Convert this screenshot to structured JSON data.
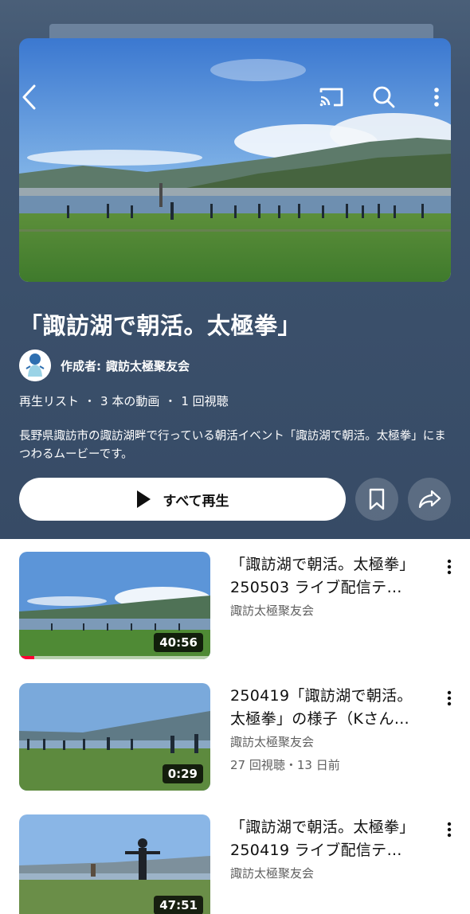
{
  "header": {
    "title": "「諏訪湖で朝活。太極拳」",
    "channel_prefix": "作成者:",
    "channel_name": "諏訪太極聚友会",
    "meta": {
      "type": "再生リスト",
      "video_count": "3 本の動画",
      "views": "1 回視聴",
      "separator": "・"
    },
    "description": "長野県諏訪市の諏訪湖畔で行っている朝活イベント「諏訪湖で朝活。太極拳」にまつわるムービーです。",
    "play_all_label": "すべて再生"
  },
  "icons": {
    "back": "chevron-left-icon",
    "cast": "cast-icon",
    "search": "search-icon",
    "more": "more-vert-icon",
    "save": "bookmark-icon",
    "share": "share-icon",
    "play": "play-icon"
  },
  "colors": {
    "header_bg": "#3a4f6a",
    "progress": "#ff0033"
  },
  "videos": [
    {
      "title_line1": "「諏訪湖で朝活。太極拳」",
      "title_line2": "250503 ライブ配信テ…",
      "channel": "諏訪太極聚友会",
      "stats": "",
      "duration": "40:56",
      "watched_fraction": 0.08
    },
    {
      "title_line1": "250419「諏訪湖で朝活。",
      "title_line2": "太極拳」の様子（Kさん…",
      "channel": "諏訪太極聚友会",
      "stats": "27 回視聴・13 日前",
      "duration": "0:29",
      "watched_fraction": 0
    },
    {
      "title_line1": "「諏訪湖で朝活。太極拳」",
      "title_line2": "250419 ライブ配信テ…",
      "channel": "諏訪太極聚友会",
      "stats": "",
      "duration": "47:51",
      "watched_fraction": 0
    }
  ]
}
